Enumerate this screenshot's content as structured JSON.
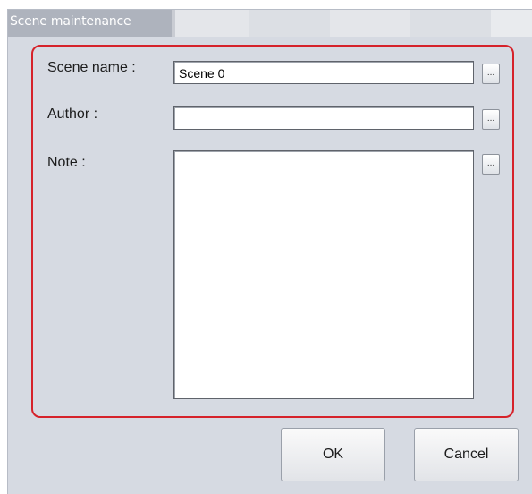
{
  "dialog": {
    "title": "Scene maintenance"
  },
  "form": {
    "scene_name": {
      "label": "Scene name :",
      "value": "Scene 0",
      "browse_label": "..."
    },
    "author": {
      "label": "Author :",
      "value": "",
      "browse_label": "..."
    },
    "note": {
      "label": "Note :",
      "value": "",
      "browse_label": "..."
    }
  },
  "buttons": {
    "ok_label": "OK",
    "cancel_label": "Cancel"
  },
  "colors": {
    "highlight_frame": "#d6222a",
    "dialog_background": "#d6dae2",
    "title_bar": "#aeb3bd"
  }
}
